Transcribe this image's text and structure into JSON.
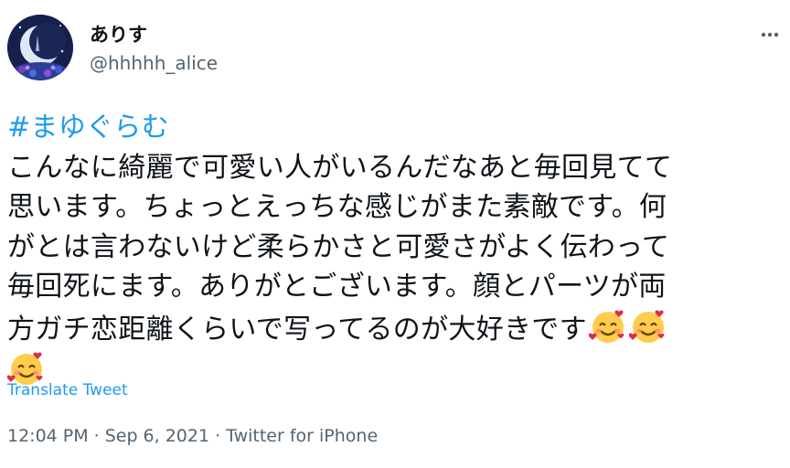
{
  "author": {
    "name": "ありす",
    "handle": "@hhhhh_alice",
    "avatar_icon": "moon-avatar-icon"
  },
  "more_icon": "more-options-icon",
  "tweet": {
    "hashtag": "#まゆぐらむ",
    "lines": [
      "こんなに綺麗で可愛い人がいるんだなあと毎回見てて",
      "思います。ちょっとえっちな感じがまた素敵です。何",
      "がとは言わないけど柔らかさと可愛さがよく伝わって",
      "毎回死にます。ありがとございます。顔とパーツが両",
      "方ガチ恋距離くらいで写ってるのが大好きです"
    ],
    "emoji_name": "smiling-face-with-hearts-emoji"
  },
  "translate_label": "Translate Tweet",
  "meta": {
    "time": "12:04 PM",
    "separator": "·",
    "date": "Sep 6, 2021",
    "source": "Twitter for iPhone"
  },
  "colors": {
    "accent": "#1d9bf0",
    "text": "#0f1419",
    "secondary": "#536471"
  }
}
